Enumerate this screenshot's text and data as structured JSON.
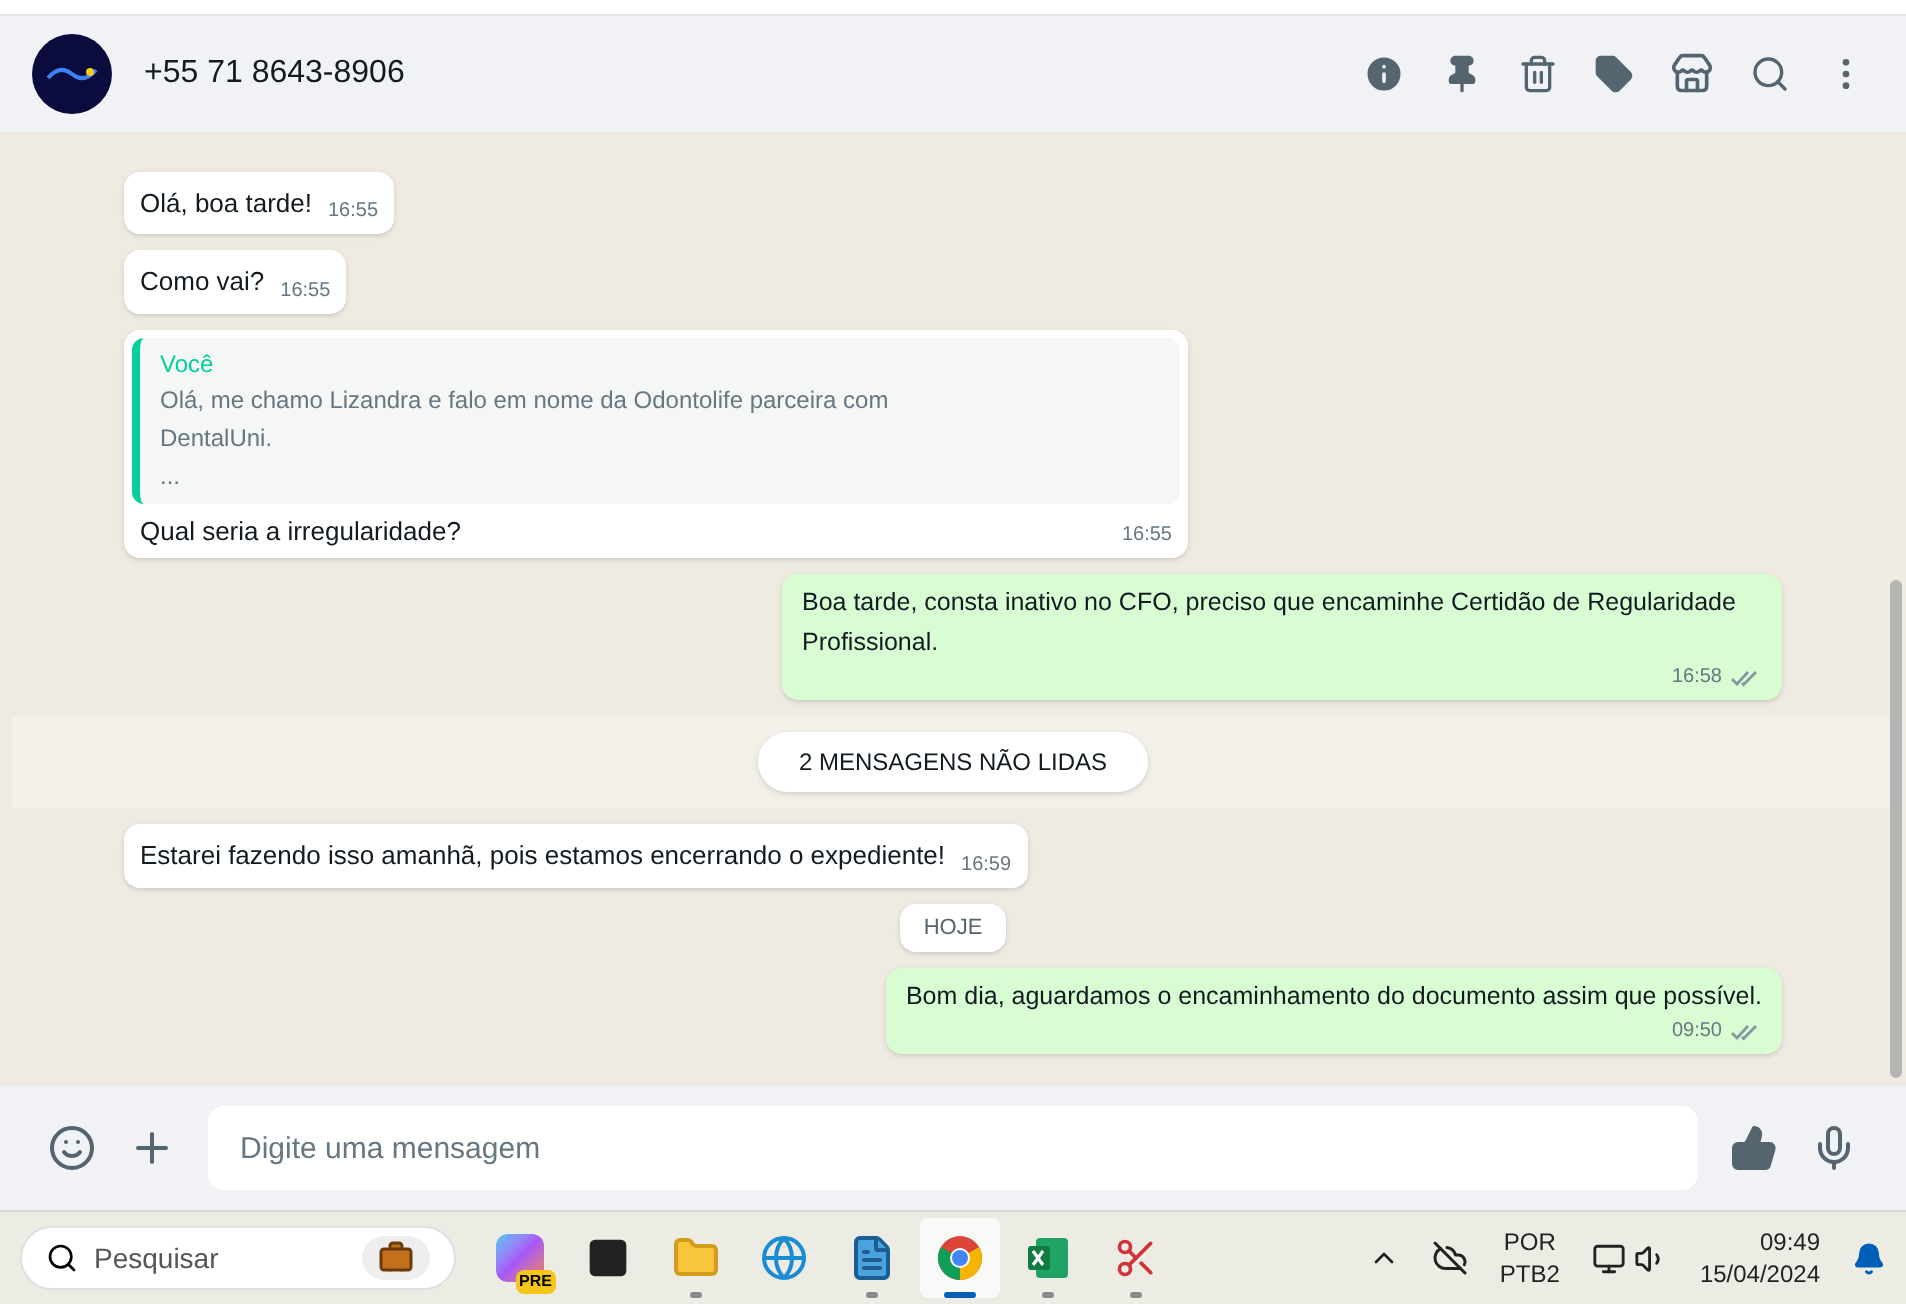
{
  "header": {
    "contact": "+55 71 8643-8906"
  },
  "messages": [
    {
      "kind": "incoming",
      "text": "Olá, boa tarde!",
      "time": "16:55"
    },
    {
      "kind": "incoming",
      "text": "Como vai?",
      "time": "16:55"
    },
    {
      "kind": "reply",
      "quote_author": "Você",
      "quote_lines": [
        "Olá, me chamo Lizandra e falo em nome da Odontolife parceira com",
        "DentalUni.",
        "..."
      ],
      "text": "Qual seria a irregularidade?",
      "time": "16:55"
    },
    {
      "kind": "outgoing",
      "text": "Boa tarde, consta inativo no CFO, preciso que encaminhe Certidão de Regularidade Profissional.",
      "time": "16:58",
      "read": false
    },
    {
      "kind": "unread",
      "text": "2 MENSAGENS NÃO LIDAS"
    },
    {
      "kind": "incoming",
      "text": "Estarei fazendo isso amanhã, pois estamos encerrando o expediente!",
      "time": "16:59"
    },
    {
      "kind": "date",
      "text": "HOJE"
    },
    {
      "kind": "outgoing",
      "text": "Bom dia, aguardamos o encaminhamento do documento assim que possível.",
      "time": "09:50",
      "read": false
    }
  ],
  "composer": {
    "placeholder": "Digite uma mensagem"
  },
  "taskbar": {
    "search_placeholder": "Pesquisar",
    "apps": [
      {
        "kind": "copilot",
        "badge": "PRE",
        "selected": false,
        "running": false
      },
      {
        "kind": "taskview",
        "selected": false,
        "running": false
      },
      {
        "kind": "files",
        "selected": false,
        "running": true
      },
      {
        "kind": "edge",
        "selected": false,
        "running": false
      },
      {
        "kind": "notepad",
        "selected": false,
        "running": true
      },
      {
        "kind": "chrome",
        "selected": true,
        "running": true
      },
      {
        "kind": "excel",
        "selected": false,
        "running": true
      },
      {
        "kind": "snip",
        "selected": false,
        "running": true
      }
    ],
    "language": "POR",
    "layout": "PTB2",
    "time": "09:49",
    "date": "15/04/2024"
  }
}
